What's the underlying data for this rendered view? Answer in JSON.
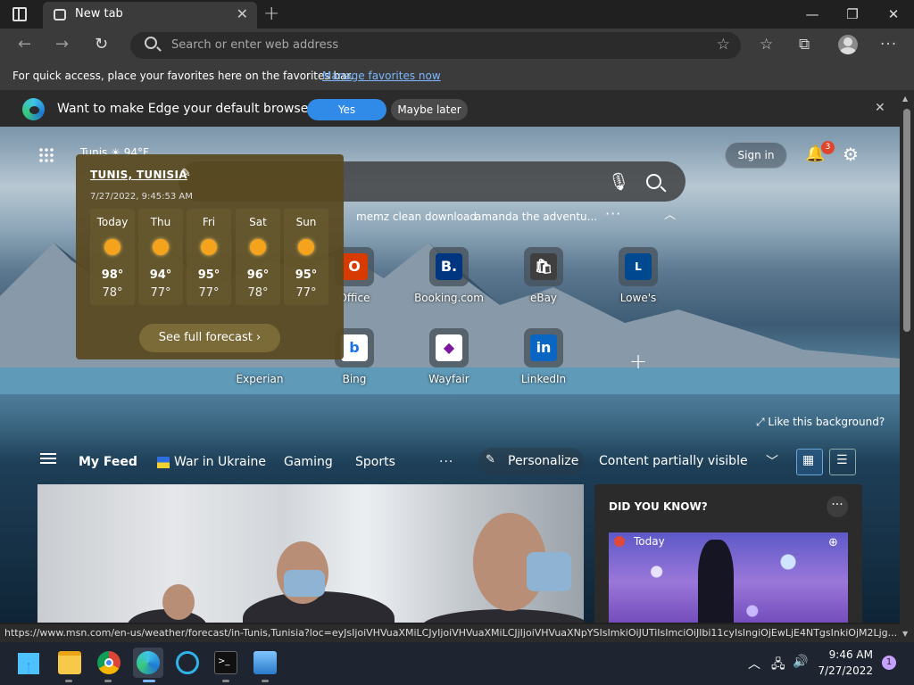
{
  "browser": {
    "tab_title": "New tab",
    "address_placeholder": "Search or enter web address",
    "favorites_hint": "For quick access, place your favorites here on the favorites bar.",
    "favorites_link": "Manage favorites now"
  },
  "banner": {
    "question": "Want to make Edge your default browser?",
    "yes": "Yes",
    "later": "Maybe later"
  },
  "ntp": {
    "weather_peek": "Tunis  ☀ 94°F",
    "sign_in": "Sign in",
    "notif_count": "3",
    "trending": [
      "memz clean download",
      "amanda the adventu..."
    ],
    "trending_more": "···",
    "tiles": [
      {
        "label": "Office",
        "glyph": "O",
        "color": "#d83b01"
      },
      {
        "label": "Booking.com",
        "glyph": "B.",
        "color": "#003580"
      },
      {
        "label": "eBay",
        "glyph": "🛍",
        "color": "#3f3f3f"
      },
      {
        "label": "Lowe's",
        "glyph": "L",
        "color": "#004990"
      },
      {
        "label": "Experian",
        "glyph": "",
        "color": "#555"
      },
      {
        "label": "Bing",
        "glyph": "b",
        "color": "#ffffff"
      },
      {
        "label": "Wayfair",
        "glyph": "◆",
        "color": "#ffffff"
      },
      {
        "label": "LinkedIn",
        "glyph": "in",
        "color": "#0a66c2"
      }
    ],
    "like_background": "Like this background?"
  },
  "weather": {
    "city": "TUNIS, TUNISIA",
    "timestamp": "7/27/2022, 9:45:53 AM",
    "days": [
      {
        "name": "Today",
        "hi": "98°",
        "lo": "78°"
      },
      {
        "name": "Thu",
        "hi": "94°",
        "lo": "77°"
      },
      {
        "name": "Fri",
        "hi": "95°",
        "lo": "77°"
      },
      {
        "name": "Sat",
        "hi": "96°",
        "lo": "78°"
      },
      {
        "name": "Sun",
        "hi": "95°",
        "lo": "77°"
      }
    ],
    "forecast_button": "See full forecast ›"
  },
  "feed": {
    "my_feed": "My Feed",
    "tabs": [
      "War in Ukraine",
      "Gaming",
      "Sports"
    ],
    "more": "···",
    "personalize": "Personalize",
    "content_visible": "Content partially visible"
  },
  "cards": {
    "did_you_know": "DID YOU KNOW?",
    "today": "Today"
  },
  "status_url": "https://www.msn.com/en-us/weather/forecast/in-Tunis,Tunisia?loc=eyJsIjoiVHVuaXMiLCJyIjoiVHVuaXMiLCJjIjoiVHVuaXNpYSIsImkiOiJUTiIsImciOiJlbi11cyIsIngiOjEwLjE4NTgsInkiOjM2Ljg...",
  "taskbar": {
    "time": "9:46 AM",
    "date": "7/27/2022",
    "notifications": "1"
  },
  "colors": {
    "accent": "#2f8ae8",
    "link": "#7cb7ff",
    "weather_panel": "#584820"
  }
}
